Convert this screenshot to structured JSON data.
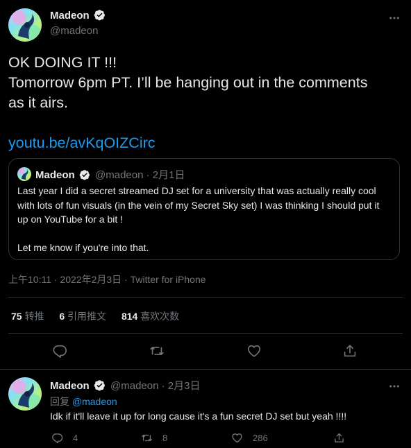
{
  "main_tweet": {
    "author_name": "Madeon",
    "author_handle": "@madeon",
    "text_line_1": "OK DOING IT !!!",
    "text_line_2": "Tomorrow 6pm PT. I’ll be hanging out in the comments",
    "text_line_3": "as it airs.",
    "link_text": "youtu.be/avKqOIZCirc",
    "timestamp": "上午10:11 · 2022年2月3日 · Twitter for iPhone"
  },
  "quoted_tweet": {
    "author_name": "Madeon",
    "author_handle": "@madeon",
    "date": "· 2月1日",
    "text_para_1": "Last year I did a secret streamed DJ set for a university that was actually really cool with lots of fun visuals (in the vein of my Secret Sky set) I was thinking I should put it up on YouTube for a bit !",
    "text_para_2": "Let me know if you're into that."
  },
  "stats": {
    "retweets_count": "75",
    "retweets_label": "转推",
    "quotes_count": "6",
    "quotes_label": "引用推文",
    "likes_count": "814",
    "likes_label": "喜欢次数"
  },
  "reply_tweet": {
    "author_name": "Madeon",
    "author_handle": "@madeon",
    "date": "· 2月3日",
    "replying_prefix": "回复",
    "replying_to": "@madeon",
    "text": "Idk if it'll leave it up for long cause it's a fun secret DJ set but yeah !!!!",
    "reply_count": "4",
    "retweet_count": "8",
    "like_count": "286"
  },
  "colors": {
    "background": "#000000",
    "text": "#e7e9ea",
    "muted": "#71767b",
    "accent": "#1d9bf0",
    "border": "#2f3336"
  },
  "icons": [
    "more-icon",
    "verified-icon",
    "reply-icon",
    "retweet-icon",
    "like-icon",
    "share-icon"
  ]
}
